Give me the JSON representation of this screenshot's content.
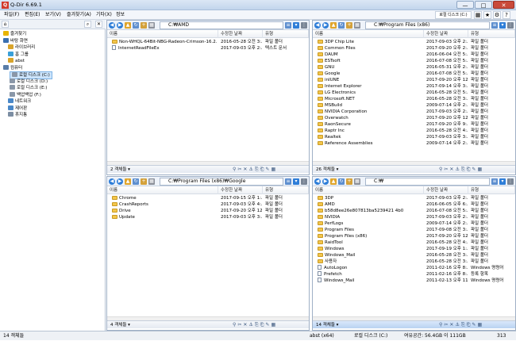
{
  "window": {
    "title": "Q-Dir 6.69.1",
    "app_icon": "Q",
    "minimize": "—",
    "maximize": "□",
    "close": "✕"
  },
  "menu": {
    "items": [
      "파일(F)",
      "편집(E)",
      "보기(V)",
      "즐겨찾기(A)",
      "기타(X)",
      "정보"
    ],
    "right_label": "로컬 디스크 (C:)"
  },
  "tree": {
    "items": [
      {
        "label": "즐겨찾기",
        "icon": "star-icon",
        "color": "#e8b400"
      },
      {
        "label": "바탕 화면",
        "icon": "desktop-icon",
        "color": "#3a6fb0"
      },
      {
        "label": "라이브러리",
        "icon": "library-icon",
        "color": "#d9a42a"
      },
      {
        "label": "홈 그룹",
        "icon": "homegroup-icon",
        "color": "#3aa0d8"
      },
      {
        "label": "abst",
        "icon": "user-folder-icon",
        "color": "#d9a42a"
      },
      {
        "label": "컴퓨터",
        "icon": "computer-icon",
        "color": "#5a7da8"
      },
      {
        "label": "로컬 디스크 (C:)",
        "icon": "drive-icon",
        "color": "#8a97a8",
        "selected": true
      },
      {
        "label": "로컬 디스크 (D:)",
        "icon": "drive-icon",
        "color": "#8a97a8"
      },
      {
        "label": "로컬 디스크 (E:)",
        "icon": "drive-icon",
        "color": "#8a97a8"
      },
      {
        "label": "백업백업 (F:)",
        "icon": "drive-icon",
        "color": "#8a97a8"
      },
      {
        "label": "네트워크",
        "icon": "network-icon",
        "color": "#4a88c8"
      },
      {
        "label": "제어판",
        "icon": "control-panel-icon",
        "color": "#4a88c8"
      },
      {
        "label": "휴지통",
        "icon": "recycle-bin-icon",
        "color": "#7c8ea3"
      }
    ]
  },
  "columns": {
    "name": "이름",
    "date": "수정한 날짜",
    "type": "유형"
  },
  "panes": {
    "tl": {
      "path": "C:₩AMD",
      "status": "2 객체들 ▾",
      "rows": [
        {
          "name": "Non-WHQL-64Bit-NBG-Radeon-Crimson-16.2.1-...",
          "date": "2016-05-28 오전 3:...",
          "type": "파일 폴더",
          "kind": "folder"
        },
        {
          "name": "InternetReadFileEx",
          "date": "2017-09-03 오후 2:...",
          "type": "텍스트 문서",
          "kind": "file"
        }
      ]
    },
    "tr": {
      "path": "C:₩Program Files (x86)",
      "status": "26 객체들 ▾",
      "rows": [
        {
          "name": "3DP Chip Lite",
          "date": "2017-09-03 오후 2:...",
          "type": "파일 폴더",
          "kind": "folder"
        },
        {
          "name": "Common Files",
          "date": "2017-09-20 오후 2:...",
          "type": "파일 폴더",
          "kind": "folder"
        },
        {
          "name": "DAUM",
          "date": "2016-06-04 오전 5:...",
          "type": "파일 폴더",
          "kind": "folder"
        },
        {
          "name": "ESTsoft",
          "date": "2016-07-08 오전 5:...",
          "type": "파일 폴더",
          "kind": "folder"
        },
        {
          "name": "GNU",
          "date": "2016-05-31 오후 2:...",
          "type": "파일 폴더",
          "kind": "folder"
        },
        {
          "name": "Google",
          "date": "2016-07-08 오전 5:...",
          "type": "파일 폴더",
          "kind": "folder"
        },
        {
          "name": "inIUNE",
          "date": "2017-09-20 오후 12:...",
          "type": "파일 폴더",
          "kind": "folder"
        },
        {
          "name": "Internet Explorer",
          "date": "2017-09-14 오후 3:...",
          "type": "파일 폴더",
          "kind": "folder"
        },
        {
          "name": "LG Electronics",
          "date": "2016-05-28 오전 5:...",
          "type": "파일 폴더",
          "kind": "folder"
        },
        {
          "name": "Microsoft.NET",
          "date": "2016-05-28 오전 3:...",
          "type": "파일 폴더",
          "kind": "folder"
        },
        {
          "name": "MSBuild",
          "date": "2009-07-14 오후 2:...",
          "type": "파일 폴더",
          "kind": "folder"
        },
        {
          "name": "NVIDIA Corporation",
          "date": "2017-09-03 오후 2:...",
          "type": "파일 폴더",
          "kind": "folder"
        },
        {
          "name": "Overwatch",
          "date": "2017-09-20 오후 12:...",
          "type": "파일 폴더",
          "kind": "folder"
        },
        {
          "name": "RaonSecure",
          "date": "2017-09-20 오후 9:...",
          "type": "파일 폴더",
          "kind": "folder"
        },
        {
          "name": "Raptr Inc",
          "date": "2016-05-28 오전 4:...",
          "type": "파일 폴더",
          "kind": "folder"
        },
        {
          "name": "Realtek",
          "date": "2017-09-03 오후 3:...",
          "type": "파일 폴더",
          "kind": "folder"
        },
        {
          "name": "Reference Assemblies",
          "date": "2009-07-14 오후 2:...",
          "type": "파일 폴더",
          "kind": "folder"
        }
      ]
    },
    "bl": {
      "path": "C:₩Program Files (x86)₩Google",
      "status": "4 객체들 ▾",
      "rows": [
        {
          "name": "Chrome",
          "date": "2017-09-15 오후 1:...",
          "type": "파일 폴더",
          "kind": "folder"
        },
        {
          "name": "CrashReports",
          "date": "2017-09-03 오후 4:...",
          "type": "파일 폴더",
          "kind": "folder"
        },
        {
          "name": "Drive",
          "date": "2017-09-20 오후 12:...",
          "type": "파일 폴더",
          "kind": "folder"
        },
        {
          "name": "Update",
          "date": "2017-09-03 오후 3:...",
          "type": "파일 폴더",
          "kind": "folder"
        }
      ]
    },
    "br": {
      "path": "C:₩",
      "status": "14 객체들 ▾",
      "rows": [
        {
          "name": "3DP",
          "date": "2017-09-03 오후 2:...",
          "type": "파일 폴더",
          "kind": "folder"
        },
        {
          "name": "AMD",
          "date": "2016-06-05 오후 6:...",
          "type": "파일 폴더",
          "kind": "folder"
        },
        {
          "name": "b58d8ee26e807813ba5239421 4b0",
          "date": "2016-07-08 오전 5:...",
          "type": "파일 폴더",
          "kind": "folder"
        },
        {
          "name": "NVIDIA",
          "date": "2017-09-03 오후 2:...",
          "type": "파일 폴더",
          "kind": "folder"
        },
        {
          "name": "PerfLogs",
          "date": "2009-07-14 오후 2:...",
          "type": "파일 폴더",
          "kind": "folder"
        },
        {
          "name": "Program Files",
          "date": "2017-09-08 오전 3:...",
          "type": "파일 폴더",
          "kind": "folder"
        },
        {
          "name": "Program Files (x86)",
          "date": "2017-09-20 오후 12:...",
          "type": "파일 폴더",
          "kind": "folder"
        },
        {
          "name": "RaidTool",
          "date": "2016-05-28 오전 4:...",
          "type": "파일 폴더",
          "kind": "folder"
        },
        {
          "name": "Windows",
          "date": "2017-09-19 오후 1:...",
          "type": "파일 폴더",
          "kind": "folder"
        },
        {
          "name": "Windows_Mail",
          "date": "2016-05-28 오전 3:...",
          "type": "파일 폴더",
          "kind": "folder"
        },
        {
          "name": "사용자",
          "date": "2016-05-28 오전 3:...",
          "type": "파일 폴더",
          "kind": "folder"
        },
        {
          "name": "AutoLogon",
          "date": "2011-02-16 오후 8:...",
          "type": "Windows 명령어",
          "kind": "file"
        },
        {
          "name": "Prefetch",
          "date": "2011-02-16 오후 8:...",
          "type": "등록 항목",
          "kind": "file"
        },
        {
          "name": "Windows_Mail",
          "date": "2011-02-13 오후 11:...",
          "type": "Windows 명령어",
          "kind": "file"
        }
      ]
    }
  },
  "status_bar": {
    "left": "14 객체들",
    "user": "abst (x64)",
    "drive": "로컬 디스크 (C:)",
    "free": "여유공간: 56.4GB 이 111GB",
    "num": "313"
  }
}
